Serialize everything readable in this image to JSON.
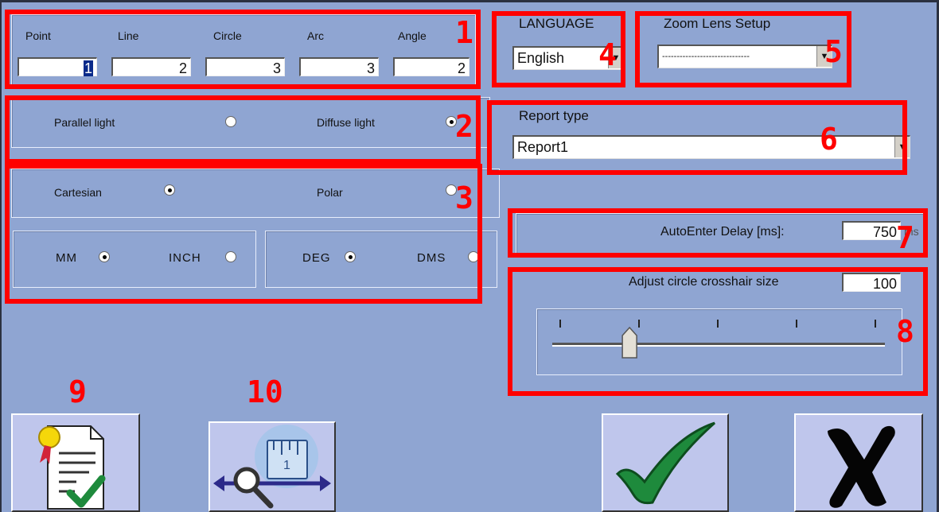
{
  "measure": {
    "labels": [
      "Point",
      "Line",
      "Circle",
      "Arc",
      "Angle"
    ],
    "values": [
      "1",
      "2",
      "3",
      "3",
      "2"
    ]
  },
  "light": {
    "parallel_label": "Parallel light",
    "diffuse_label": "Diffuse light",
    "selected": "diffuse"
  },
  "coords": {
    "cartesian_label": "Cartesian",
    "polar_label": "Polar",
    "selected": "cartesian"
  },
  "units": {
    "mm_label": "MM",
    "inch_label": "INCH",
    "length_selected": "mm",
    "deg_label": "DEG",
    "dms_label": "DMS",
    "angle_selected": "deg"
  },
  "language": {
    "label": "LANGUAGE",
    "value": "English"
  },
  "zoom": {
    "label": "Zoom Lens Setup",
    "value": "------------------------------"
  },
  "report": {
    "label": "Report type",
    "value": "Report1"
  },
  "autoenter": {
    "label": "AutoEnter Delay [ms]:",
    "value": "750",
    "unit": "ms"
  },
  "crosshair": {
    "label": "Adjust circle crosshair size",
    "value": "100",
    "slider_level": 0.22
  },
  "annotations": {
    "numbers": [
      "1",
      "2",
      "3",
      "4",
      "5",
      "6",
      "7",
      "8",
      "9",
      "10"
    ]
  },
  "icons": {
    "report_button": "certificate-document-icon",
    "calibration_button": "magnifier-ruler-icon",
    "ok_button": "checkmark-icon",
    "cancel_button": "x-cross-icon"
  },
  "colors": {
    "background": "#8fa5d2",
    "annotation": "#ff0000",
    "button_face": "#bfc6ec",
    "check": "#1e8a3c"
  }
}
